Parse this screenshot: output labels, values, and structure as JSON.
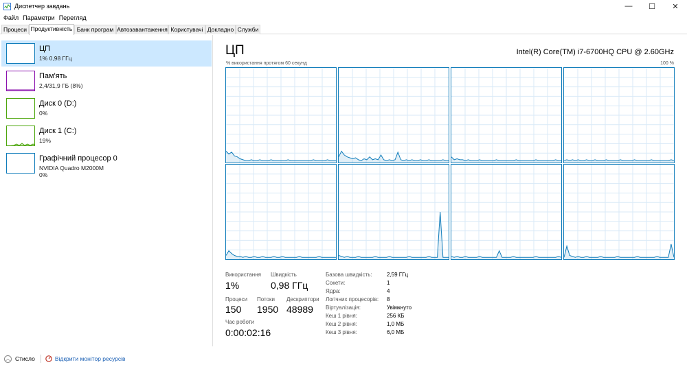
{
  "window": {
    "title": "Диспетчер завдань",
    "controls": {
      "minimize": "—",
      "maximize": "☐",
      "close": "✕"
    }
  },
  "menu": [
    "Файл",
    "Параметри",
    "Перегляд"
  ],
  "tabs": [
    "Процеси",
    "Продуктивність",
    "Банк програм",
    "Автозавантаження",
    "Користувачі",
    "Докладно",
    "Служби"
  ],
  "active_tab": "Продуктивність",
  "sidebar": {
    "items": [
      {
        "name": "ЦП",
        "sub": "1% 0,98 ГГц",
        "sub2": "",
        "color": "#117dbb",
        "selected": true
      },
      {
        "name": "Пам'ять",
        "sub": "2,4/31,9 ГБ (8%)",
        "sub2": "",
        "color": "#8b12ae",
        "selected": false
      },
      {
        "name": "Диск 0 (D:)",
        "sub": "0%",
        "sub2": "",
        "color": "#4da60c",
        "selected": false
      },
      {
        "name": "Диск 1 (C:)",
        "sub": "19%",
        "sub2": "",
        "color": "#4da60c",
        "selected": false
      },
      {
        "name": "Графічний процесор 0",
        "sub": "NVIDIA Quadro M2000M",
        "sub2": "0%",
        "color": "#117dbb",
        "selected": false
      }
    ]
  },
  "main": {
    "title": "ЦП",
    "model": "Intel(R) Core(TM) i7-6700HQ CPU @ 2.60GHz",
    "graph_caption": "% використання протягом 60 секунд",
    "graph_max": "100 %",
    "graph_color": "#117dbb",
    "cores": [
      [
        12,
        9,
        11,
        7,
        6,
        4,
        3,
        2,
        2,
        3,
        2,
        2,
        3,
        2,
        2,
        2,
        3,
        2,
        2,
        2,
        2,
        2,
        3,
        2,
        2,
        2,
        2,
        2,
        2,
        2,
        2,
        3,
        2,
        2,
        2,
        2,
        3,
        2,
        2,
        2
      ],
      [
        6,
        12,
        8,
        6,
        5,
        4,
        5,
        3,
        2,
        4,
        3,
        6,
        3,
        4,
        3,
        8,
        3,
        2,
        3,
        2,
        3,
        11,
        3,
        2,
        3,
        2,
        3,
        2,
        2,
        3,
        2,
        2,
        3,
        2,
        2,
        2,
        2,
        3,
        2,
        2
      ],
      [
        6,
        3,
        4,
        3,
        3,
        2,
        3,
        2,
        2,
        2,
        3,
        2,
        2,
        2,
        2,
        2,
        3,
        2,
        2,
        2,
        2,
        2,
        2,
        3,
        2,
        2,
        2,
        2,
        2,
        2,
        3,
        2,
        2,
        2,
        2,
        2,
        2,
        3,
        2,
        2
      ],
      [
        2,
        3,
        2,
        3,
        2,
        3,
        2,
        2,
        3,
        2,
        2,
        3,
        2,
        2,
        2,
        3,
        2,
        2,
        2,
        2,
        3,
        2,
        2,
        2,
        2,
        3,
        2,
        2,
        2,
        2,
        2,
        3,
        2,
        2,
        2,
        2,
        2,
        2,
        3,
        2
      ],
      [
        4,
        9,
        6,
        4,
        3,
        3,
        2,
        3,
        2,
        2,
        3,
        2,
        2,
        3,
        2,
        2,
        2,
        3,
        2,
        2,
        3,
        2,
        2,
        2,
        2,
        2,
        3,
        2,
        2,
        2,
        2,
        2,
        2,
        3,
        2,
        2,
        2,
        2,
        2,
        2
      ],
      [
        4,
        3,
        2,
        3,
        2,
        2,
        2,
        3,
        2,
        2,
        2,
        2,
        2,
        3,
        2,
        2,
        2,
        2,
        3,
        2,
        2,
        2,
        2,
        2,
        2,
        3,
        2,
        2,
        2,
        2,
        2,
        2,
        3,
        2,
        2,
        2,
        2,
        2,
        2,
        2
      ],
      [
        3,
        2,
        3,
        2,
        2,
        3,
        2,
        2,
        2,
        2,
        3,
        2,
        2,
        2,
        2,
        2,
        2,
        9,
        2,
        2,
        2,
        2,
        3,
        2,
        2,
        2,
        2,
        2,
        2,
        2,
        3,
        2,
        2,
        2,
        2,
        2,
        2,
        2,
        3,
        2
      ],
      [
        2,
        14,
        4,
        3,
        2,
        3,
        2,
        2,
        3,
        2,
        2,
        2,
        2,
        3,
        2,
        2,
        2,
        2,
        2,
        3,
        2,
        2,
        2,
        2,
        2,
        2,
        3,
        2,
        2,
        2,
        2,
        2,
        2,
        3,
        2,
        2,
        2,
        2,
        4,
        2
      ]
    ],
    "spikes": [
      {
        "core": 5,
        "index": 36,
        "value": 50
      },
      {
        "core": 7,
        "index": 38,
        "value": 16
      }
    ],
    "stats": {
      "usage_label": "Використання",
      "usage": "1%",
      "speed_label": "Швидкість",
      "speed": "0,98 ГГц",
      "processes_label": "Процеси",
      "processes": "150",
      "threads_label": "Потоки",
      "threads": "1950",
      "handles_label": "Дескриптори",
      "handles": "48989",
      "uptime_label": "Час роботи",
      "uptime": "0:00:02:16"
    },
    "info": [
      {
        "label": "Базова швидкість:",
        "value": "2,59 ГГц"
      },
      {
        "label": "Сокети:",
        "value": "1"
      },
      {
        "label": "Ядра:",
        "value": "4"
      },
      {
        "label": "Логічних процесорів:",
        "value": "8"
      },
      {
        "label": "Віртуалізація:",
        "value": "Увімкнуто"
      },
      {
        "label": "Кеш 1 рівня:",
        "value": "256 КБ"
      },
      {
        "label": "Кеш 2 рівня:",
        "value": "1,0 МБ"
      },
      {
        "label": "Кеш 3 рівня:",
        "value": "6,0 МБ"
      }
    ]
  },
  "footer": {
    "collapse": "Стисло",
    "monitor_link": "Відкрити монітор ресурсів"
  }
}
